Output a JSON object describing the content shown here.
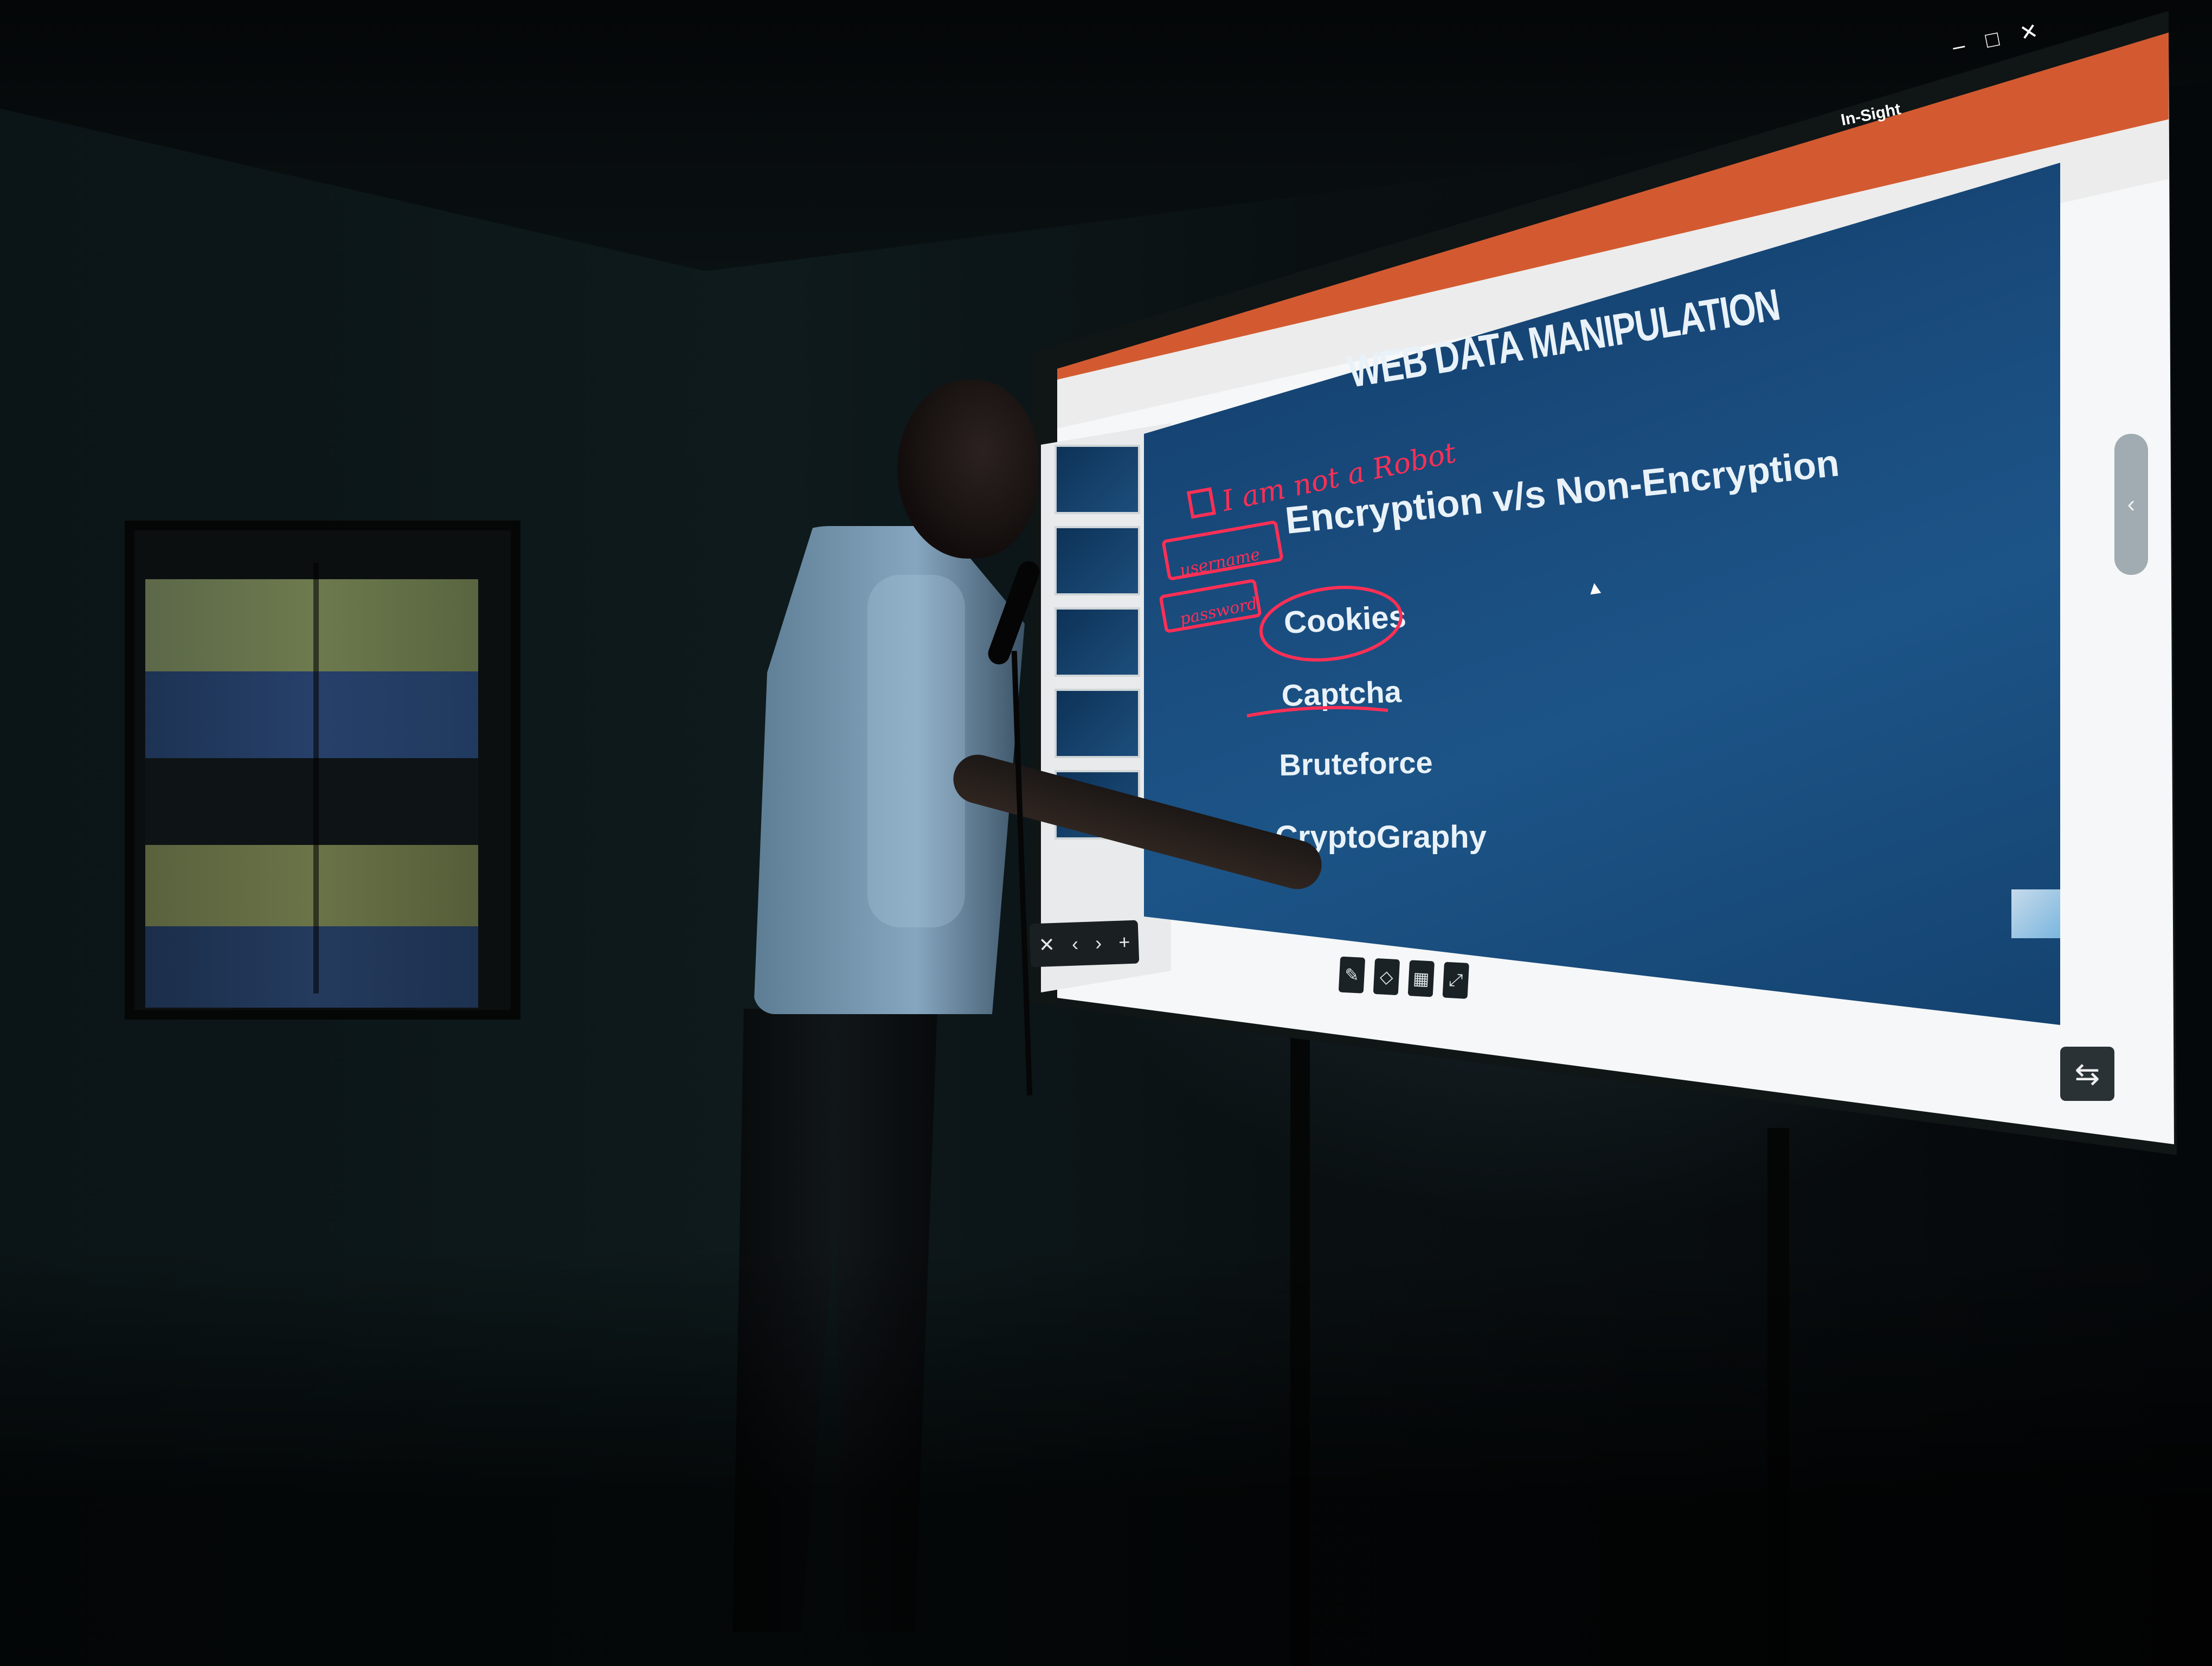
{
  "window": {
    "app_label": "In-Sight"
  },
  "slide": {
    "title": "WEB DATA MANIPULATION",
    "bullets": [
      "Encryption v/s Non-Encryption",
      "Cookies",
      "Captcha",
      "Bruteforce",
      "CryptoGraphy"
    ]
  },
  "annotations": {
    "handwritten_note": "I am not a Robot",
    "user_box": "username",
    "password_box": "password"
  },
  "colors": {
    "title_bar": "#d35a30",
    "slide_background": "#1a4c7e",
    "ink": "#ff2f55",
    "slide_text": "#e9f2f8"
  },
  "icons": {
    "close": "close-icon",
    "maximize": "maximize-icon",
    "minimize": "minimize-icon",
    "pen": "pen-icon",
    "eraser": "eraser-icon",
    "grid": "grid-icon",
    "swap": "swap-icon",
    "chevron": "chevron-left-icon"
  }
}
